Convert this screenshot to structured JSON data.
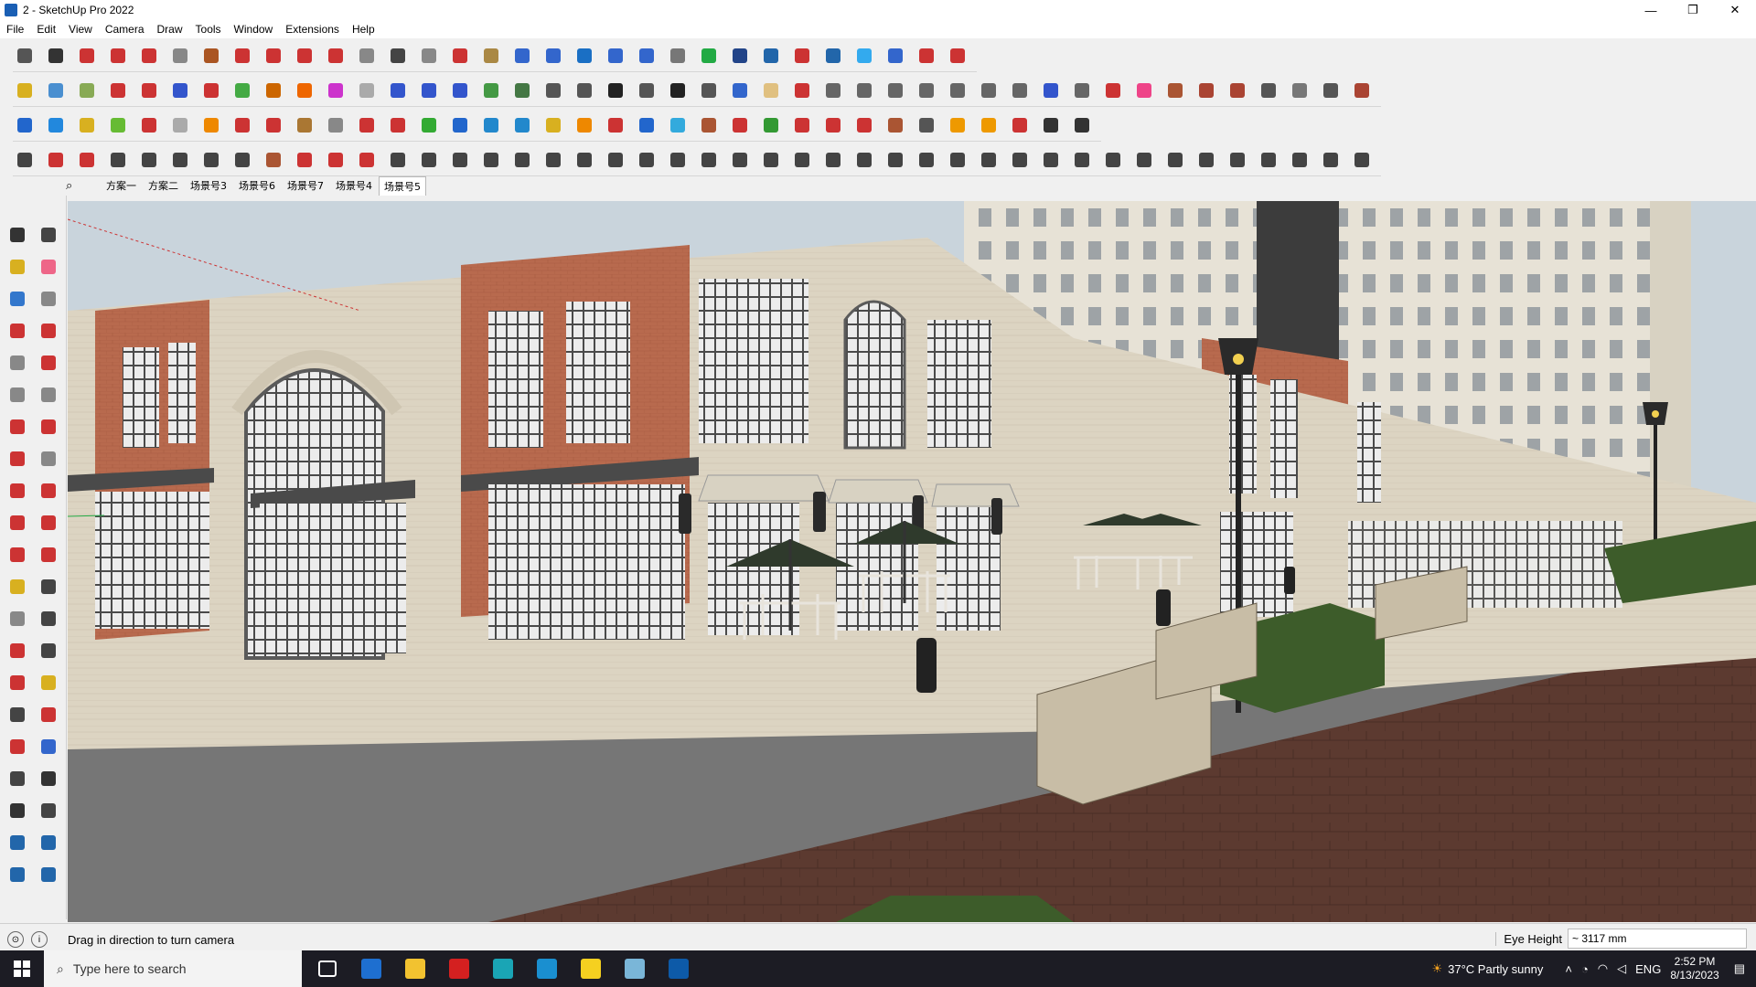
{
  "window": {
    "title": "2 - SketchUp Pro 2022",
    "controls": [
      "—",
      "❐",
      "✕"
    ]
  },
  "menu": [
    "File",
    "Edit",
    "View",
    "Camera",
    "Draw",
    "Tools",
    "Window",
    "Extensions",
    "Help"
  ],
  "toolbar_rows": [
    {
      "colors": [
        "#555",
        "#333",
        "#cc3333",
        "#cc3333",
        "#cc3333",
        "#888",
        "#aa5522",
        "#cc3333",
        "#cc3333",
        "#cc3333",
        "#cc3333",
        "#888",
        "#444",
        "#888",
        "#cc3333",
        "#aa8844",
        "#3366cc",
        "#3366cc",
        "#1a6fc4",
        "#3366cc",
        "#3366cc",
        "#777",
        "#22aa44",
        "#224488",
        "#2266aa",
        "#cc3333",
        "#2266aa",
        "#33aaee",
        "#3366cc",
        "#cc3333",
        "#cc3333"
      ]
    },
    {
      "colors": [
        "#d8b020",
        "#4a8fd0",
        "#88aa55",
        "#cc3333",
        "#cc3333",
        "#3355cc",
        "#cc3333",
        "#44aa44",
        "#cc6600",
        "#ee6600",
        "#cc33cc",
        "#aaaaaa",
        "#3355cc",
        "#3355cc",
        "#3355cc",
        "#449944",
        "#447744",
        "#555",
        "#555",
        "#222",
        "#555",
        "#222",
        "#555",
        "#3366cc",
        "#e0c080",
        "#cc3333",
        "#666",
        "#666",
        "#666",
        "#666",
        "#666",
        "#666",
        "#666",
        "#3355cc",
        "#666",
        "#cc3333",
        "#ee4488",
        "#aa5533",
        "#aa4433",
        "#aa4433",
        "#555",
        "#777",
        "#555",
        "#aa4433"
      ]
    },
    {
      "colors": [
        "#2266cc",
        "#2288dd",
        "#d8b020",
        "#66bb33",
        "#cc3333",
        "#aaaaaa",
        "#ee8800",
        "#cc3333",
        "#cc3333",
        "#aa7733",
        "#888",
        "#cc3333",
        "#cc3333",
        "#33aa33",
        "#2266cc",
        "#2288cc",
        "#2288cc",
        "#d8b020",
        "#ee8800",
        "#cc3333",
        "#2266cc",
        "#33aadd",
        "#aa5533",
        "#cc3333",
        "#339933",
        "#cc3333",
        "#cc3333",
        "#cc3333",
        "#aa5533",
        "#555",
        "#ee9900",
        "#ee9900",
        "#cc3333",
        "#333",
        "#333"
      ]
    },
    {
      "colors": [
        "#444",
        "#cc3333",
        "#cc3333",
        "#444",
        "#444",
        "#444",
        "#444",
        "#444",
        "#aa5533",
        "#cc3333",
        "#cc3333",
        "#cc3333",
        "#444",
        "#444",
        "#444",
        "#444",
        "#444",
        "#444",
        "#444",
        "#444",
        "#444",
        "#444",
        "#444",
        "#444",
        "#444",
        "#444",
        "#444",
        "#444",
        "#444",
        "#444",
        "#444",
        "#444",
        "#444",
        "#444",
        "#444",
        "#444",
        "#444",
        "#444",
        "#444",
        "#444",
        "#444",
        "#444",
        "#444",
        "#444"
      ]
    }
  ],
  "scene_tabs": [
    "方案一",
    "方案二",
    "场景号3",
    "场景号6",
    "场景号7",
    "场景号4",
    "场景号5"
  ],
  "active_scene": "场景号5",
  "left_tools": [
    {
      "name": "select-tool-icon",
      "color": "#333"
    },
    {
      "name": "orbit-tool-icon",
      "color": "#444"
    },
    {
      "name": "paint-bucket-icon",
      "color": "#d8b020"
    },
    {
      "name": "eraser-icon",
      "color": "#ee6688"
    },
    {
      "name": "component-icon",
      "color": "#3377cc"
    },
    {
      "name": "tape-icon",
      "color": "#888"
    },
    {
      "name": "line-tool-icon",
      "color": "#cc3333"
    },
    {
      "name": "freehand-icon",
      "color": "#cc3333"
    },
    {
      "name": "rectangle-icon",
      "color": "#888"
    },
    {
      "name": "rotated-rect-icon",
      "color": "#cc3333"
    },
    {
      "name": "circle-icon",
      "color": "#888"
    },
    {
      "name": "polygon-icon",
      "color": "#888"
    },
    {
      "name": "arc-icon",
      "color": "#cc3333"
    },
    {
      "name": "arc2-icon",
      "color": "#cc3333"
    },
    {
      "name": "arc3-icon",
      "color": "#cc3333"
    },
    {
      "name": "pie-icon",
      "color": "#888"
    },
    {
      "name": "move-icon",
      "color": "#cc3333"
    },
    {
      "name": "push-pull-icon",
      "color": "#cc3333"
    },
    {
      "name": "rotate-icon",
      "color": "#cc3333"
    },
    {
      "name": "follow-me-icon",
      "color": "#cc3333"
    },
    {
      "name": "scale-icon",
      "color": "#cc3333"
    },
    {
      "name": "offset-icon",
      "color": "#cc3333"
    },
    {
      "name": "measure-icon",
      "color": "#d8b020"
    },
    {
      "name": "dimension-icon",
      "color": "#444"
    },
    {
      "name": "protractor-icon",
      "color": "#888"
    },
    {
      "name": "text-icon",
      "color": "#444"
    },
    {
      "name": "axes-icon",
      "color": "#cc3333"
    },
    {
      "name": "3d-text-icon",
      "color": "#444"
    },
    {
      "name": "orbit2-icon",
      "color": "#cc3333"
    },
    {
      "name": "pan-icon",
      "color": "#d8b020"
    },
    {
      "name": "zoom-icon",
      "color": "#444"
    },
    {
      "name": "zoom-window-icon",
      "color": "#cc3333"
    },
    {
      "name": "zoom-extents-icon",
      "color": "#cc3333"
    },
    {
      "name": "previous-view-icon",
      "color": "#3366cc"
    },
    {
      "name": "position-camera-icon",
      "color": "#444"
    },
    {
      "name": "look-around-icon",
      "color": "#333"
    },
    {
      "name": "walk-icon",
      "color": "#333"
    },
    {
      "name": "section-plane-icon",
      "color": "#444"
    },
    {
      "name": "display-section-icon",
      "color": "#2266aa"
    },
    {
      "name": "section-cuts-icon",
      "color": "#2266aa"
    },
    {
      "name": "layers-icon",
      "color": "#2266aa"
    },
    {
      "name": "section-fill-icon",
      "color": "#2266aa"
    }
  ],
  "status": {
    "hint": "Drag in direction to turn camera",
    "label": "Eye Height",
    "value": "~ 3117 mm"
  },
  "taskbar": {
    "search_placeholder": "Type here to search",
    "apps": [
      {
        "name": "task-view-icon",
        "color": "#ffffff"
      },
      {
        "name": "calculator-icon",
        "color": "#1e6fd0"
      },
      {
        "name": "file-explorer-icon",
        "color": "#f2c230"
      },
      {
        "name": "acrobat-icon",
        "color": "#d42020"
      },
      {
        "name": "3dsmax-icon",
        "color": "#1aa5b5"
      },
      {
        "name": "edge-icon",
        "color": "#1a8fd0"
      },
      {
        "name": "sticky-notes-icon",
        "color": "#f5d020"
      },
      {
        "name": "app-icon",
        "color": "#7ab6d8"
      },
      {
        "name": "sketchup-icon",
        "color": "#0d5aa8"
      }
    ],
    "weather": "37°C  Partly sunny",
    "lang": "ENG",
    "time": "2:52 PM",
    "date": "8/13/2023"
  }
}
